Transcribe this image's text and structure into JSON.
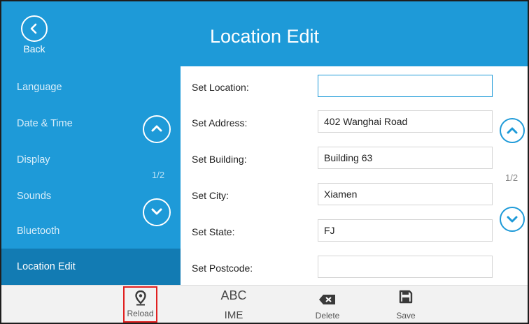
{
  "header": {
    "title": "Location Edit",
    "back_label": "Back"
  },
  "sidebar": {
    "items": [
      {
        "label": "Language"
      },
      {
        "label": "Date & Time"
      },
      {
        "label": "Display"
      },
      {
        "label": "Sounds"
      },
      {
        "label": "Bluetooth"
      },
      {
        "label": "Location Edit",
        "active": true
      }
    ],
    "page_indicator": "1/2"
  },
  "form": {
    "rows": [
      {
        "label": "Set Location:",
        "value": ""
      },
      {
        "label": "Set Address:",
        "value": "402 Wanghai Road"
      },
      {
        "label": "Set Building:",
        "value": "Building 63"
      },
      {
        "label": "Set City:",
        "value": "Xiamen"
      },
      {
        "label": "Set State:",
        "value": "FJ"
      },
      {
        "label": "Set Postcode:",
        "value": ""
      }
    ],
    "page_indicator": "1/2"
  },
  "softkeys": {
    "reload": "Reload",
    "ime_top": "ABC",
    "ime": "IME",
    "delete": "Delete",
    "save": "Save"
  },
  "colors": {
    "brand_blue": "#1e9ad8",
    "active_item": "#127bb3",
    "highlight_box": "#e02020"
  }
}
